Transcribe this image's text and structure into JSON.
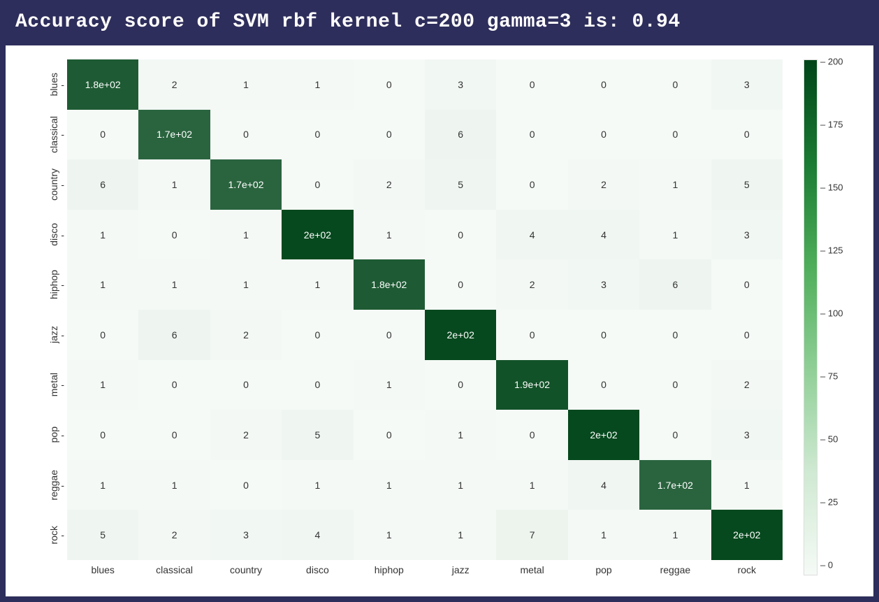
{
  "title": "Accuracy score of SVM rbf kernel c=200 gamma=3 is: 0.94",
  "chart_data": {
    "type": "heatmap",
    "title": "Accuracy score of SVM rbf kernel c=200 gamma=3 is: 0.94",
    "xlabel": "",
    "ylabel": "",
    "row_labels": [
      "blues",
      "classical",
      "country",
      "disco",
      "hiphop",
      "jazz",
      "metal",
      "pop",
      "reggae",
      "rock"
    ],
    "col_labels": [
      "blues",
      "classical",
      "country",
      "disco",
      "hiphop",
      "jazz",
      "metal",
      "pop",
      "reggae",
      "rock"
    ],
    "values": [
      [
        180,
        2,
        1,
        1,
        0,
        3,
        0,
        0,
        0,
        3
      ],
      [
        0,
        170,
        0,
        0,
        0,
        6,
        0,
        0,
        0,
        0
      ],
      [
        6,
        1,
        170,
        0,
        2,
        5,
        0,
        2,
        1,
        5
      ],
      [
        1,
        0,
        1,
        200,
        1,
        0,
        4,
        4,
        1,
        3
      ],
      [
        1,
        1,
        1,
        1,
        180,
        0,
        2,
        3,
        6,
        0
      ],
      [
        0,
        6,
        2,
        0,
        0,
        200,
        0,
        0,
        0,
        0
      ],
      [
        1,
        0,
        0,
        0,
        1,
        0,
        190,
        0,
        0,
        2
      ],
      [
        0,
        0,
        2,
        5,
        0,
        1,
        0,
        200,
        0,
        3
      ],
      [
        1,
        1,
        0,
        1,
        1,
        1,
        1,
        4,
        170,
        1
      ],
      [
        5,
        2,
        3,
        4,
        1,
        1,
        7,
        1,
        1,
        200
      ]
    ],
    "display_values": [
      [
        "1.8e+02",
        "2",
        "1",
        "1",
        "0",
        "3",
        "0",
        "0",
        "0",
        "3"
      ],
      [
        "0",
        "1.7e+02",
        "0",
        "0",
        "0",
        "6",
        "0",
        "0",
        "0",
        "0"
      ],
      [
        "6",
        "1",
        "1.7e+02",
        "0",
        "2",
        "5",
        "0",
        "2",
        "1",
        "5"
      ],
      [
        "1",
        "0",
        "1",
        "2e+02",
        "1",
        "0",
        "4",
        "4",
        "1",
        "3"
      ],
      [
        "1",
        "1",
        "1",
        "1",
        "1.8e+02",
        "0",
        "2",
        "3",
        "6",
        "0"
      ],
      [
        "0",
        "6",
        "2",
        "0",
        "0",
        "2e+02",
        "0",
        "0",
        "0",
        "0"
      ],
      [
        "1",
        "0",
        "0",
        "0",
        "1",
        "0",
        "1.9e+02",
        "0",
        "0",
        "2"
      ],
      [
        "0",
        "0",
        "2",
        "5",
        "0",
        "1",
        "0",
        "2e+02",
        "0",
        "3"
      ],
      [
        "1",
        "1",
        "0",
        "1",
        "1",
        "1",
        "1",
        "4",
        "1.7e+02",
        "1"
      ],
      [
        "5",
        "2",
        "3",
        "4",
        "1",
        "1",
        "7",
        "1",
        "1",
        "2e+02"
      ]
    ],
    "colorbar": {
      "min": 0,
      "max": 205,
      "ticks": [
        0,
        25,
        50,
        75,
        100,
        125,
        150,
        175,
        200
      ]
    },
    "colormap": "Greens"
  }
}
